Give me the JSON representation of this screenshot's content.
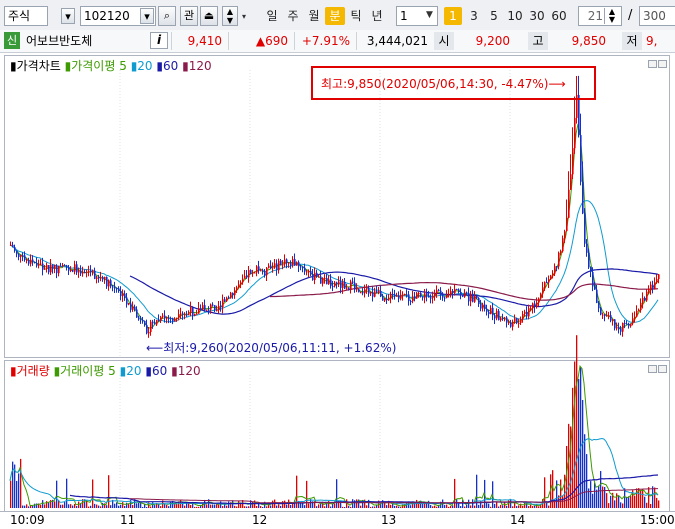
{
  "toolbar": {
    "market_type": "주식",
    "code": "102120",
    "chevron": "⌄",
    "search": "⌕",
    "interest": "관",
    "period_tabs": [
      "일",
      "주",
      "월",
      "분",
      "틱",
      "년"
    ],
    "interval_value": "1",
    "minute_tabs": [
      "1",
      "3",
      "5",
      "10",
      "30",
      "60"
    ],
    "count_value": "21",
    "slash": "/",
    "total_count": "300"
  },
  "stock": {
    "badge": "신",
    "name": "어보브반도체",
    "info": "i",
    "price": "9,410",
    "change": "▲690",
    "rate": "+7.91%",
    "volume": "3,444,021",
    "open_label": "시",
    "open": "9,200",
    "high_label": "고",
    "high": "9,850",
    "low_label": "저",
    "low": "9,"
  },
  "price_panel": {
    "title": "가격차트",
    "ma_title": "가격이평",
    "ma_periods": [
      "5",
      "20",
      "60",
      "120"
    ],
    "high_annotation": "최고:9,850(2020/05/06,14:30, -4.47%)⟶",
    "low_annotation": "⟵최저:9,260(2020/05/06,11:11, +1.62%)"
  },
  "volume_panel": {
    "title": "거래량",
    "ma_title": "거래이평",
    "ma_periods": [
      "5",
      "20",
      "60",
      "120"
    ]
  },
  "x_axis": [
    "10:09",
    "11",
    "12",
    "13",
    "14",
    "15:00"
  ],
  "colors": {
    "up": "#e00000",
    "down": "#1530c8",
    "ma5": "#3d9a00",
    "ma20": "#0f9bd0",
    "ma60": "#1a1aa8",
    "ma120": "#8a1a4a",
    "annotation_box": "#e00000"
  },
  "chart_data": {
    "type": "candlestick",
    "price_high": 9850,
    "price_low": 9260,
    "last_price": 9410
  }
}
